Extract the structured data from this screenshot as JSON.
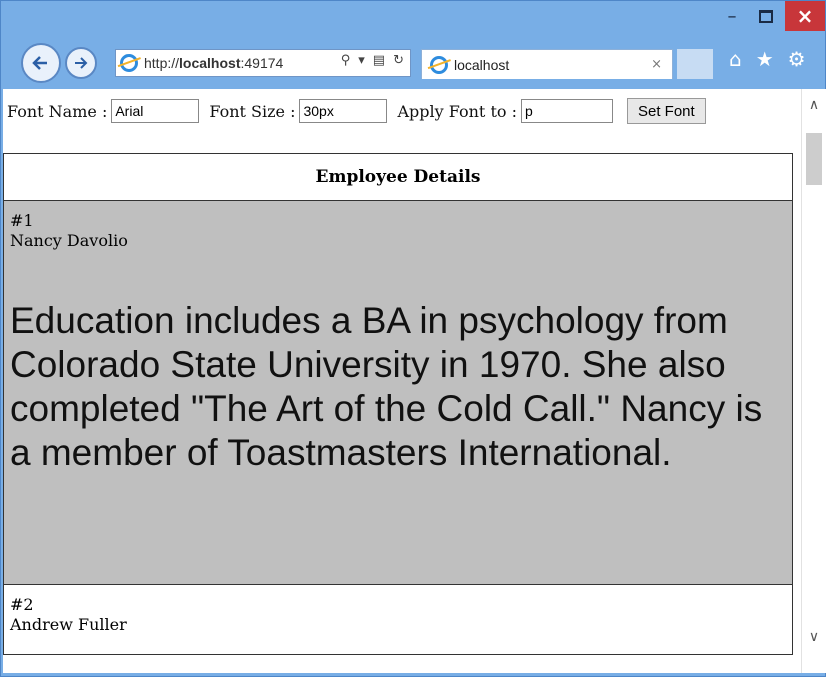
{
  "window": {
    "minimize": "–",
    "close": "×"
  },
  "nav": {
    "url_prefix": "http://",
    "url_host": "localhost",
    "url_port": ":49174",
    "tab_title": "localhost",
    "tab_close": "×"
  },
  "form": {
    "font_name_label": "Font Name :",
    "font_name_value": "Arial",
    "font_size_label": "Font Size :",
    "font_size_value": "30px",
    "apply_to_label": "Apply Font to :",
    "apply_to_value": "p",
    "set_font_button": "Set Font"
  },
  "table": {
    "header": "Employee Details",
    "rows": [
      {
        "id": "#1",
        "name": "Nancy Davolio",
        "notes": "Education includes a BA in psychology from Colorado State University in 1970. She also completed \"The Art of the Cold Call.\" Nancy is a member of Toastmasters International."
      },
      {
        "id": "#2",
        "name": "Andrew Fuller"
      }
    ]
  }
}
